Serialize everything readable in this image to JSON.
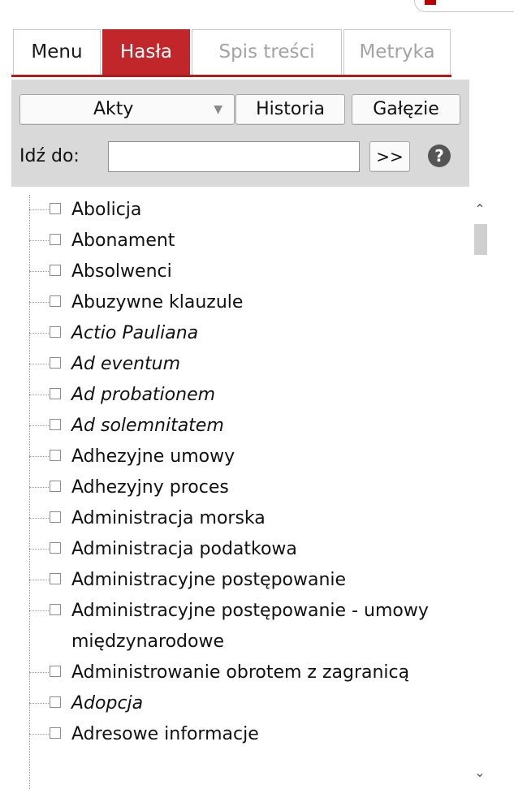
{
  "tabs": [
    {
      "label": "Menu"
    },
    {
      "label": "Hasła",
      "active": true
    },
    {
      "label": "Spis treści"
    },
    {
      "label": "Metryka"
    }
  ],
  "toolbar": {
    "select_value": "Akty",
    "history_label": "Historia",
    "branches_label": "Gałęzie",
    "goto_label": "Idź do:",
    "goto_value": "",
    "go_label": ">>",
    "help_glyph": "?"
  },
  "tree": {
    "items": [
      {
        "label": "Abolicja",
        "italic": false
      },
      {
        "label": "Abonament",
        "italic": false
      },
      {
        "label": "Absolwenci",
        "italic": false
      },
      {
        "label": "Abuzywne klauzule",
        "italic": false
      },
      {
        "label": "Actio Pauliana",
        "italic": true
      },
      {
        "label": "Ad eventum",
        "italic": true
      },
      {
        "label": "Ad probationem",
        "italic": true
      },
      {
        "label": "Ad solemnitatem",
        "italic": true
      },
      {
        "label": "Adhezyjne umowy",
        "italic": false
      },
      {
        "label": "Adhezyjny proces",
        "italic": false
      },
      {
        "label": "Administracja morska",
        "italic": false
      },
      {
        "label": "Administracja podatkowa",
        "italic": false
      },
      {
        "label": "Administracyjne postępowanie",
        "italic": false
      },
      {
        "label": "Administracyjne postępowanie - umowy międzynarodowe",
        "italic": false
      },
      {
        "label": "Administrowanie obrotem z zagranicą",
        "italic": false
      },
      {
        "label": "Adopcja",
        "italic": true
      },
      {
        "label": "Adresowe informacje",
        "italic": false
      }
    ]
  },
  "colors": {
    "accent": "#c0262a",
    "toolbar_bg": "#d9d9d9",
    "inactive_tab_text": "#a3a3a3"
  }
}
